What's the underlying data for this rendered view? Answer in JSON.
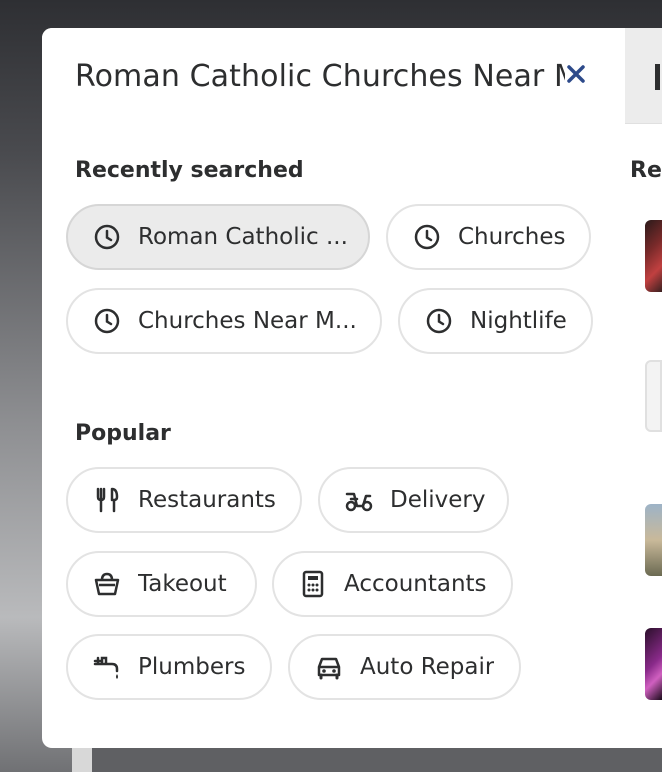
{
  "search": {
    "query": "Roman Catholic Churches Near M",
    "close_icon": "close-icon"
  },
  "recent": {
    "title": "Recently searched",
    "items": [
      {
        "label": "Roman Catholic ...",
        "icon": "clock-icon"
      },
      {
        "label": "Churches",
        "icon": "clock-icon"
      },
      {
        "label": "Churches Near M...",
        "icon": "clock-icon"
      },
      {
        "label": "Nightlife",
        "icon": "clock-icon"
      }
    ]
  },
  "popular": {
    "title": "Popular",
    "items": [
      {
        "label": "Restaurants",
        "icon": "fork-knife-icon"
      },
      {
        "label": "Delivery",
        "icon": "scooter-icon"
      },
      {
        "label": "Takeout",
        "icon": "takeout-bag-icon"
      },
      {
        "label": "Accountants",
        "icon": "calculator-icon"
      },
      {
        "label": "Plumbers",
        "icon": "faucet-icon"
      },
      {
        "label": "Auto Repair",
        "icon": "car-icon"
      }
    ]
  },
  "right_panel": {
    "heading": "Rec"
  },
  "colors": {
    "text": "#2d2e2f",
    "close": "#2d4a8a",
    "chip_border": "#e3e3e3",
    "chip_active_bg": "#ebebeb"
  }
}
